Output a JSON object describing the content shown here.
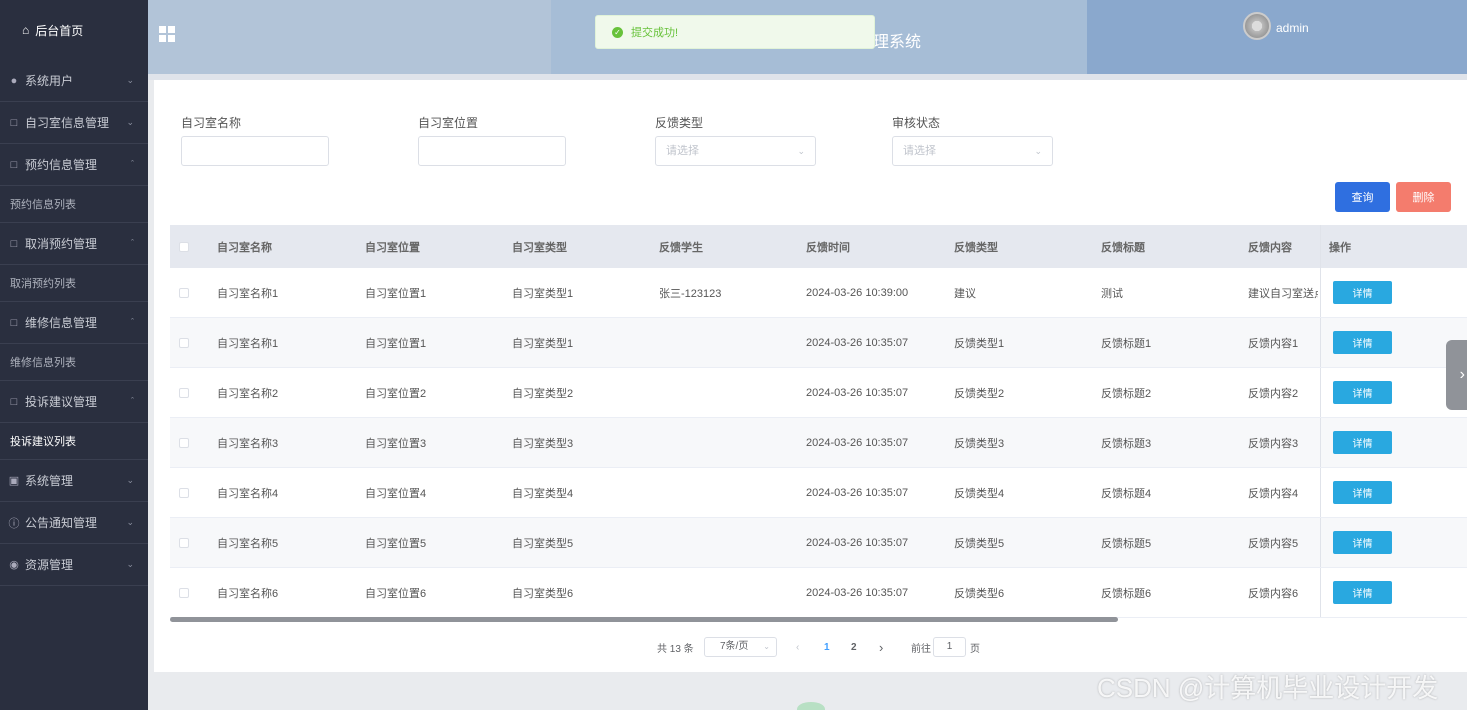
{
  "sidebar": {
    "home": "后台首页",
    "groups": [
      {
        "label": "系统用户",
        "icon": "user-icon",
        "expanded": false
      },
      {
        "label": "自习室信息管理",
        "icon": "folder-icon",
        "expanded": false
      },
      {
        "label": "预约信息管理",
        "icon": "folder-icon",
        "expanded": true,
        "sub": "预约信息列表"
      },
      {
        "label": "取消预约管理",
        "icon": "folder-icon",
        "expanded": true,
        "sub": "取消预约列表"
      },
      {
        "label": "维修信息管理",
        "icon": "folder-icon",
        "expanded": true,
        "sub": "维修信息列表"
      },
      {
        "label": "投诉建议管理",
        "icon": "folder-icon",
        "expanded": true,
        "sub": "投诉建议列表"
      },
      {
        "label": "系统管理",
        "icon": "image-icon",
        "expanded": false
      },
      {
        "label": "公告通知管理",
        "icon": "info-icon",
        "expanded": false
      },
      {
        "label": "资源管理",
        "icon": "location-icon",
        "expanded": false
      }
    ]
  },
  "header": {
    "title_partial": "理系统",
    "username": "admin"
  },
  "toast": {
    "message": "提交成功!"
  },
  "search": {
    "name_label": "自习室名称",
    "location_label": "自习室位置",
    "type_label": "反馈类型",
    "status_label": "审核状态",
    "type_placeholder": "请选择",
    "status_placeholder": "请选择",
    "query_btn": "查询",
    "delete_btn": "删除"
  },
  "table": {
    "headers": [
      "自习室名称",
      "自习室位置",
      "自习室类型",
      "反馈学生",
      "反馈时间",
      "反馈类型",
      "反馈标题",
      "反馈内容",
      "操作"
    ],
    "detail_btn": "详情",
    "rows": [
      [
        "自习室名称1",
        "自习室位置1",
        "自习室类型1",
        "张三-123123",
        "2024-03-26 10:39:00",
        "建议",
        "测试",
        "建议自习室送点"
      ],
      [
        "自习室名称1",
        "自习室位置1",
        "自习室类型1",
        "",
        "2024-03-26 10:35:07",
        "反馈类型1",
        "反馈标题1",
        "反馈内容1"
      ],
      [
        "自习室名称2",
        "自习室位置2",
        "自习室类型2",
        "",
        "2024-03-26 10:35:07",
        "反馈类型2",
        "反馈标题2",
        "反馈内容2"
      ],
      [
        "自习室名称3",
        "自习室位置3",
        "自习室类型3",
        "",
        "2024-03-26 10:35:07",
        "反馈类型3",
        "反馈标题3",
        "反馈内容3"
      ],
      [
        "自习室名称4",
        "自习室位置4",
        "自习室类型4",
        "",
        "2024-03-26 10:35:07",
        "反馈类型4",
        "反馈标题4",
        "反馈内容4"
      ],
      [
        "自习室名称5",
        "自习室位置5",
        "自习室类型5",
        "",
        "2024-03-26 10:35:07",
        "反馈类型5",
        "反馈标题5",
        "反馈内容5"
      ],
      [
        "自习室名称6",
        "自习室位置6",
        "自习室类型6",
        "",
        "2024-03-26 10:35:07",
        "反馈类型6",
        "反馈标题6",
        "反馈内容6"
      ]
    ]
  },
  "pagination": {
    "total": "共 13 条",
    "page_size": "7条/页",
    "pages": [
      "1",
      "2"
    ],
    "current": "1",
    "goto_label": "前往",
    "goto_value": "1",
    "page_suffix": "页"
  },
  "watermark": "CSDN @计算机毕业设计开发"
}
